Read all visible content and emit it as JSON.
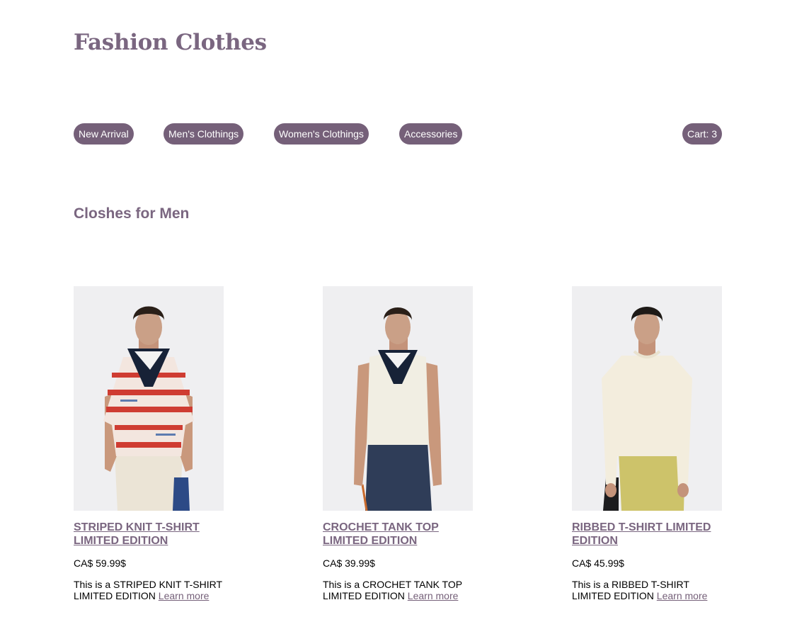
{
  "site": {
    "title": "Fashion Clothes"
  },
  "nav": {
    "items": [
      {
        "label": "New Arrival"
      },
      {
        "label": "Men's Clothings"
      },
      {
        "label": "Women's Clothings"
      },
      {
        "label": "Accessories"
      }
    ],
    "cart_label": "Cart: 3"
  },
  "section": {
    "title": "Closhes for Men"
  },
  "products": [
    {
      "title": "STRIPED KNIT T-SHIRT LIMITED EDITION",
      "price": "CA$ 59.99$",
      "desc": "This is a STRIPED KNIT T-SHIRT LIMITED EDITION",
      "link": "Learn more"
    },
    {
      "title": "CROCHET TANK TOP LIMITED EDITION",
      "price": "CA$ 39.99$",
      "desc": "This is a CROCHET TANK TOP LIMITED EDITION",
      "link": "Learn more"
    },
    {
      "title": "RIBBED T-SHIRT LIMITED EDITION",
      "price": "CA$ 45.99$",
      "desc": "This is a RIBBED T-SHIRT LIMITED EDITION",
      "link": "Learn more"
    }
  ],
  "colors": {
    "accent": "#756079",
    "title": "#7a6680",
    "photo_background": "#efeff1"
  }
}
